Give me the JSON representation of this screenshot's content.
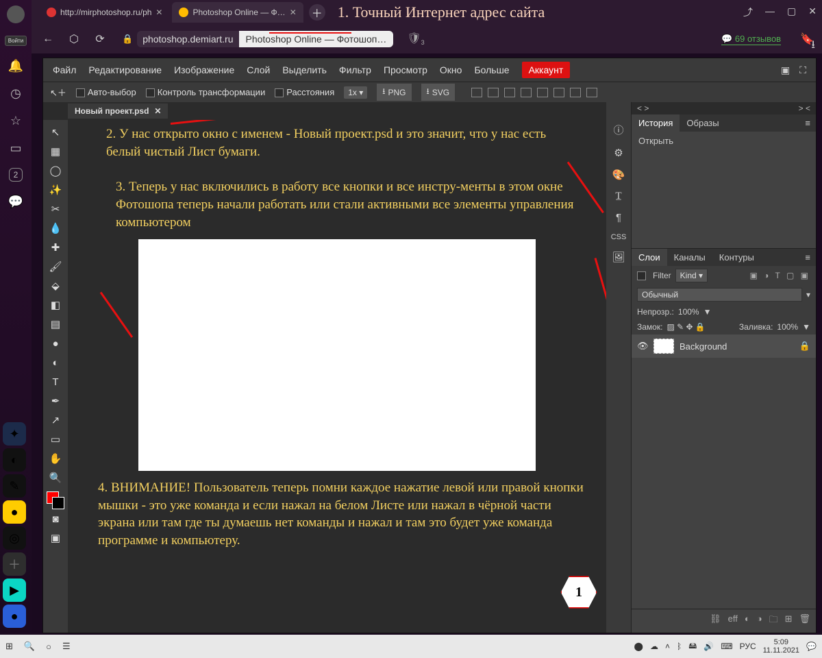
{
  "os_sidebar": {
    "login": "Войти"
  },
  "browser": {
    "tabs": [
      {
        "label": "http://mirphotoshop.ru/ph",
        "fav": "#d33"
      },
      {
        "label": "Photoshop Online — Ф…",
        "fav": "#fb0"
      }
    ],
    "annot": "1. Точный Интернет адрес сайта",
    "domain": "photoshop.demiart.ru",
    "page_title": "Photoshop Online — Фотошоп…",
    "reviews": "69 отзывов"
  },
  "app": {
    "menus": [
      "Файл",
      "Редактирование",
      "Изображение",
      "Слой",
      "Выделить",
      "Фильтр",
      "Просмотр",
      "Окно",
      "Больше"
    ],
    "account": "Аккаунт",
    "opts": {
      "auto": "Авто-выбор",
      "transform": "Контроль трансформации",
      "dist": "Расстояния",
      "zoom": "1x",
      "png": "PNG",
      "svg": "SVG"
    },
    "doc_tab": "Новый проект.psd",
    "right_strip_css": "CSS",
    "history": {
      "tabs": [
        "История",
        "Образы"
      ],
      "item": "Открыть"
    },
    "layers": {
      "tabs": [
        "Слои",
        "Каналы",
        "Контуры"
      ],
      "filter": "Filter",
      "kind": "Kind",
      "blend": "Обычный",
      "opacity_l": "Непрозр.:",
      "opacity_v": "100%",
      "lock_l": "Замок:",
      "fill_l": "Заливка:",
      "fill_v": "100%",
      "layer_name": "Background",
      "foot_eff": "eff"
    }
  },
  "notes": {
    "n2": "2. У нас открыто окно с именем - Новый проект.psd и это значит, что у нас есть белый чистый Лист бумаги.",
    "n3": "3. Теперь у нас включились в работу все кнопки и все инстру-менты в этом окне Фотошопа теперь начали работать или стали активными все элементы управления компьютером",
    "n4": "4. ВНИМАНИЕ!  Пользователь теперь помни каждое нажатие левой или правой кнопки мышки - это уже команда и если нажал на белом Листе  или нажал в  чёрной части экрана или там где ты думаешь нет команды и нажал и там это будет уже команда программе и компьютеру.",
    "hex": "1"
  },
  "taskbar": {
    "lang": "РУС",
    "time": "5:09",
    "date": "11.11.2021"
  }
}
